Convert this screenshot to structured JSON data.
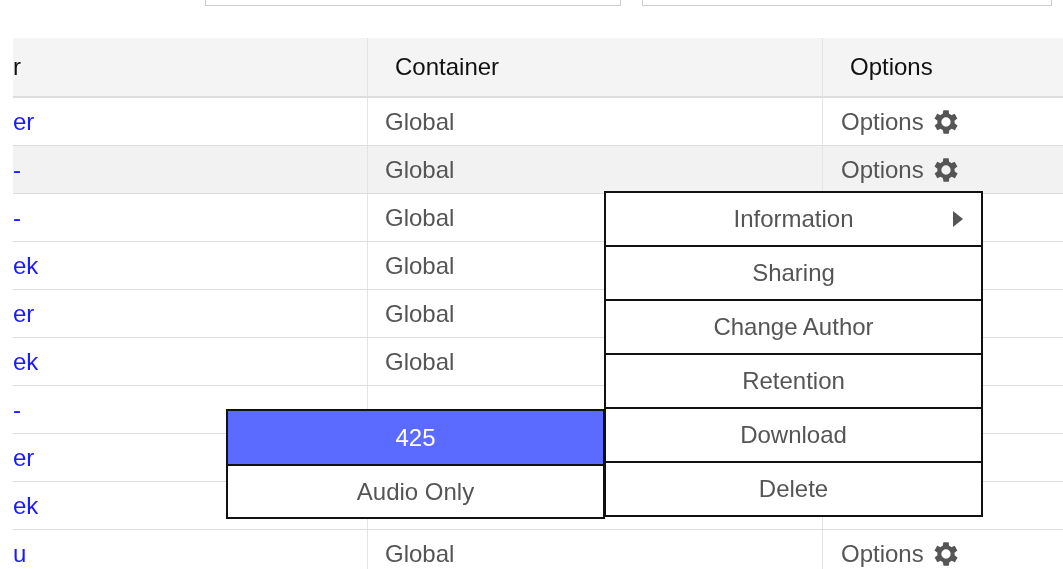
{
  "filters": [
    {
      "kind": "field"
    },
    {
      "kind": "field"
    }
  ],
  "table": {
    "columns": [
      "r",
      "Container",
      "Options"
    ],
    "rows": [
      {
        "name": "er",
        "container": "Global",
        "options": "Options",
        "hover": false
      },
      {
        "name": "-",
        "container": "Global",
        "options": "Options",
        "hover": true
      },
      {
        "name": "-",
        "container": "Global",
        "hover": false
      },
      {
        "name": "ek",
        "container": "Global",
        "hover": false
      },
      {
        "name": "er",
        "container": "Global",
        "hover": false
      },
      {
        "name": "ek",
        "container": "Global",
        "hover": false
      },
      {
        "name": "-",
        "hover": false
      },
      {
        "name": "er",
        "hover": false
      },
      {
        "name": "ek",
        "hover": false
      },
      {
        "name": "u",
        "container": "Global",
        "options": "Options",
        "hover": false
      }
    ]
  },
  "context_menu": {
    "items": [
      {
        "label": "Information",
        "has_submenu": true
      },
      {
        "label": "Sharing",
        "has_submenu": false
      },
      {
        "label": "Change Author",
        "has_submenu": false
      },
      {
        "label": "Retention",
        "has_submenu": false
      },
      {
        "label": "Download",
        "has_submenu": false
      },
      {
        "label": "Delete",
        "has_submenu": false
      }
    ]
  },
  "submenu": {
    "items": [
      {
        "label": "425",
        "selected": true
      },
      {
        "label": "Audio Only",
        "selected": false
      }
    ]
  }
}
